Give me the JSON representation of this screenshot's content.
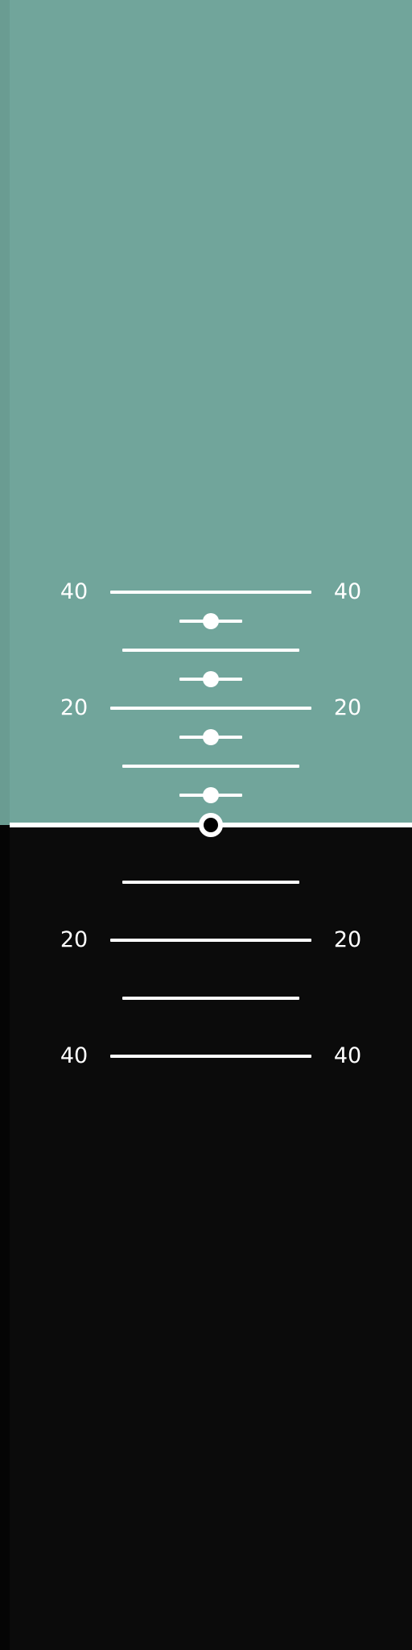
{
  "theme": {
    "sky_color": "#71a59b",
    "sky_edge_color": "#6a9c92",
    "ground_color": "#0b0b0b",
    "ground_edge_color": "#050505",
    "line_color": "#ffffff"
  },
  "pitch_ladder": {
    "up_40": {
      "left": "40",
      "right": "40"
    },
    "up_20": {
      "left": "20",
      "right": "20"
    },
    "down_20": {
      "left": "20",
      "right": "20"
    },
    "down_40": {
      "left": "40",
      "right": "40"
    }
  },
  "attitude": {
    "pitch_deg": 0,
    "roll_deg": 0
  }
}
